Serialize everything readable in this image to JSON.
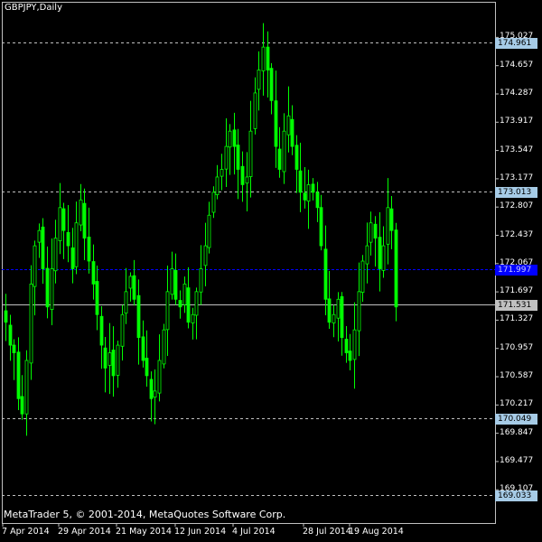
{
  "window": {
    "title": "GBPJPY,Daily",
    "copyright": "MetaTrader 5, © 2001-2014, MetaQuotes Software Corp."
  },
  "colors": {
    "background": "#000000",
    "candle": "#00ff00",
    "grid": "#c0c0c0",
    "bid_line": "#0000ff",
    "ask_line": "#c0c0c0",
    "level_label_bg": "#a6cbe6"
  },
  "chart_data": {
    "type": "line",
    "title": "GBPJPY,Daily",
    "xlabel": "",
    "ylabel": "",
    "ylim": [
      168.897,
      175.327
    ],
    "y_tick_labels": [
      "175.027",
      "174.657",
      "174.287",
      "173.917",
      "173.547",
      "173.177",
      "172.807",
      "172.437",
      "172.067",
      "171.697",
      "171.327",
      "170.957",
      "170.587",
      "170.217",
      "169.847",
      "169.477",
      "169.107"
    ],
    "x_tick_labels": [
      "7 Apr 2014",
      "29 Apr 2014",
      "21 May 2014",
      "12 Jun 2014",
      "4 Jul 2014",
      "28 Jul 2014",
      "19 Aug 2014"
    ],
    "horizontal_levels": [
      {
        "label": "174.961",
        "value": 174.961,
        "style": "dashed"
      },
      {
        "label": "173.013",
        "value": 173.013,
        "style": "dashed"
      },
      {
        "label": "170.049",
        "value": 170.049,
        "style": "dashed"
      },
      {
        "label": "169.033",
        "value": 169.033,
        "style": "dashed"
      }
    ],
    "bid_line": {
      "label": "171.997",
      "value": 171.997
    },
    "ask_line": {
      "label": "171.531",
      "value": 171.531
    },
    "series": [
      {
        "close": [
          171.3,
          171.0,
          170.9,
          170.3,
          170.1,
          170.8,
          171.8,
          172.3,
          172.5,
          172.0,
          171.5,
          172.0,
          172.4,
          172.8,
          172.5,
          172.3,
          172.0,
          172.6,
          172.9,
          172.4,
          172.1,
          171.8,
          171.4,
          171.0,
          170.7,
          170.9,
          170.6,
          171.0,
          171.4,
          171.7,
          171.9,
          171.6,
          171.1,
          170.8,
          170.6,
          170.3,
          170.4,
          170.8,
          171.2,
          171.7,
          172.0,
          171.6,
          171.5,
          171.8,
          171.3,
          171.4,
          171.7,
          172.0,
          172.3,
          172.7,
          173.0,
          173.2,
          173.3,
          173.6,
          173.8,
          173.6,
          173.3,
          173.1,
          173.2,
          173.8,
          174.3,
          174.6,
          174.9,
          174.6,
          174.2,
          173.6,
          173.3,
          173.8,
          174.0,
          173.6,
          173.3,
          173.0,
          172.9,
          173.1,
          173.0,
          172.8,
          172.3,
          171.6,
          171.3,
          171.4,
          171.6,
          171.1,
          170.9,
          170.8,
          171.2,
          171.7,
          172.1,
          172.3,
          172.6,
          172.4,
          172.0,
          172.3,
          172.8,
          172.5,
          171.5
        ]
      }
    ]
  }
}
